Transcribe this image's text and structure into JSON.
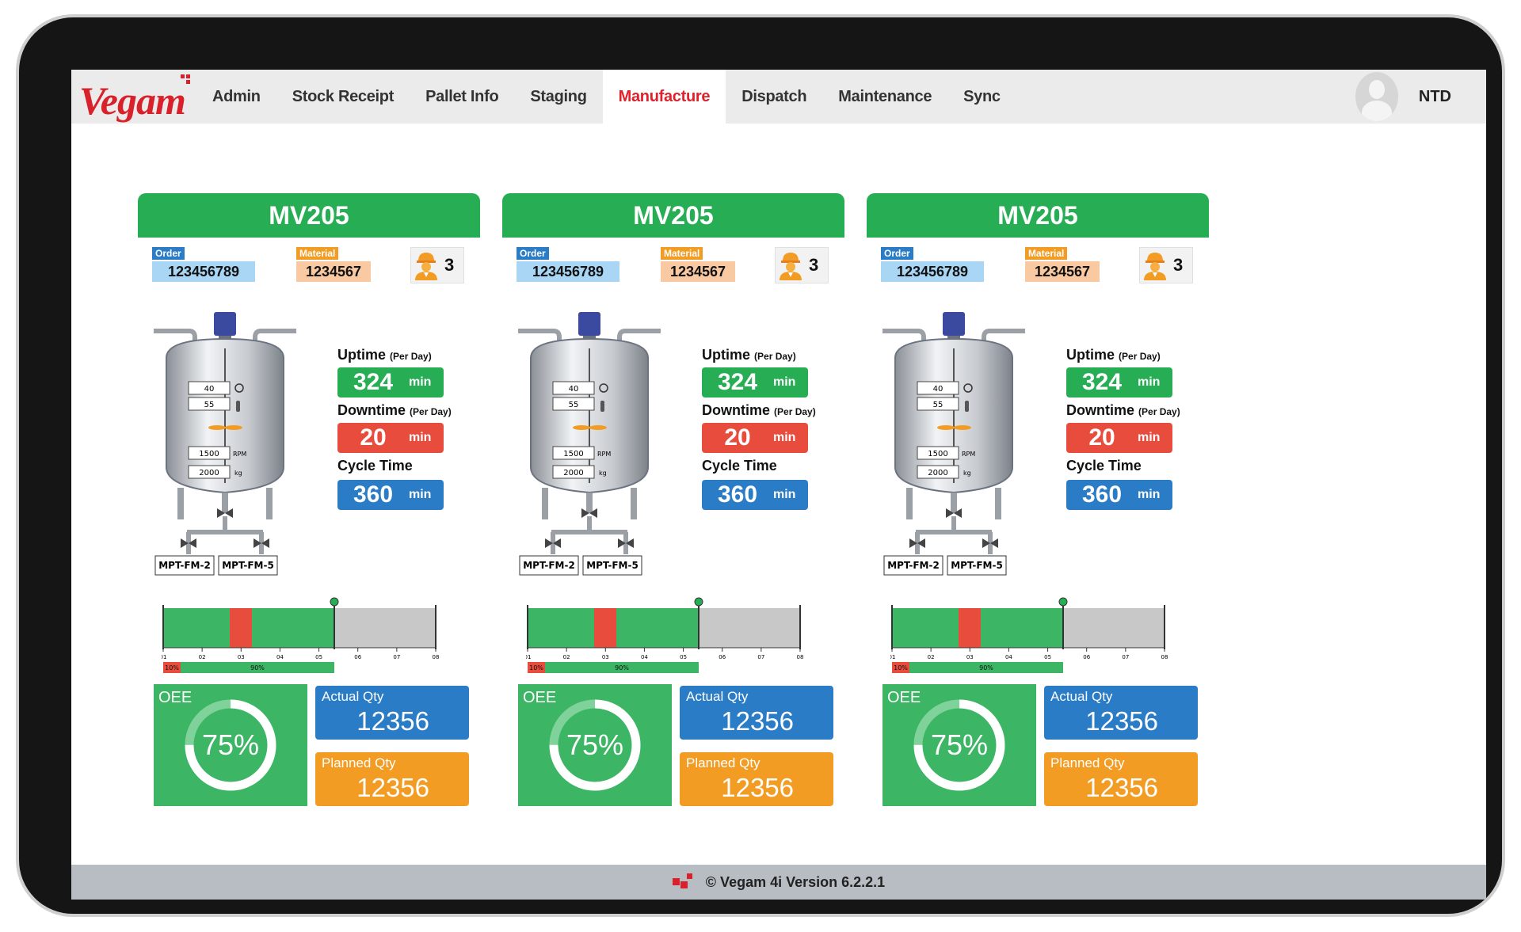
{
  "nav": {
    "logo": "Vegam",
    "items": [
      {
        "label": "Admin",
        "active": false
      },
      {
        "label": "Stock Receipt",
        "active": false
      },
      {
        "label": "Pallet Info",
        "active": false
      },
      {
        "label": "Staging",
        "active": false
      },
      {
        "label": "Manufacture",
        "active": true
      },
      {
        "label": "Dispatch",
        "active": false
      },
      {
        "label": "Maintenance",
        "active": false
      },
      {
        "label": "Sync",
        "active": false
      }
    ],
    "user": "NTD"
  },
  "labels": {
    "order": "Order",
    "material": "Material",
    "uptime": "Uptime",
    "downtime": "Downtime",
    "per_day": "(Per Day)",
    "cycle_time": "Cycle Time",
    "unit": "min",
    "oee": "OEE",
    "actual_qty": "Actual Qty",
    "planned_qty": "Planned Qty",
    "rpm": "RPM",
    "kg": "kg"
  },
  "panels": [
    {
      "title": "MV205",
      "order": "123456789",
      "material": "1234567",
      "workers": "3",
      "tank": {
        "pressure": "40",
        "temperature": "55",
        "rpm": "1500",
        "weight": "2000",
        "outlet_a": "MPT-FM-2",
        "outlet_b": "MPT-FM-5"
      },
      "uptime": "324",
      "downtime": "20",
      "cycle_time": "360",
      "timeline": {
        "ticks": [
          "01",
          "02",
          "03",
          "04",
          "05",
          "06",
          "07",
          "08"
        ],
        "down_pct": "10%",
        "up_pct": "90%"
      },
      "oee": "75%",
      "oee_fraction": 0.75,
      "actual_qty": "12356",
      "planned_qty": "12356"
    },
    {
      "title": "MV205",
      "order": "123456789",
      "material": "1234567",
      "workers": "3",
      "tank": {
        "pressure": "40",
        "temperature": "55",
        "rpm": "1500",
        "weight": "2000",
        "outlet_a": "MPT-FM-2",
        "outlet_b": "MPT-FM-5"
      },
      "uptime": "324",
      "downtime": "20",
      "cycle_time": "360",
      "timeline": {
        "ticks": [
          "01",
          "02",
          "03",
          "04",
          "05",
          "06",
          "07",
          "08"
        ],
        "down_pct": "10%",
        "up_pct": "90%"
      },
      "oee": "75%",
      "oee_fraction": 0.75,
      "actual_qty": "12356",
      "planned_qty": "12356"
    },
    {
      "title": "MV205",
      "order": "123456789",
      "material": "1234567",
      "workers": "3",
      "tank": {
        "pressure": "40",
        "temperature": "55",
        "rpm": "1500",
        "weight": "2000",
        "outlet_a": "MPT-FM-2",
        "outlet_b": "MPT-FM-5"
      },
      "uptime": "324",
      "downtime": "20",
      "cycle_time": "360",
      "timeline": {
        "ticks": [
          "01",
          "02",
          "03",
          "04",
          "05",
          "06",
          "07",
          "08"
        ],
        "down_pct": "10%",
        "up_pct": "90%"
      },
      "oee": "75%",
      "oee_fraction": 0.75,
      "actual_qty": "12356",
      "planned_qty": "12356"
    }
  ],
  "footer": {
    "text": "© Vegam 4i Version 6.2.2.1"
  },
  "colors": {
    "green": "#27ae55",
    "red": "#e74c3c",
    "blue": "#2a7cc7",
    "orange": "#f39c23",
    "active_nav": "#e0202a"
  }
}
